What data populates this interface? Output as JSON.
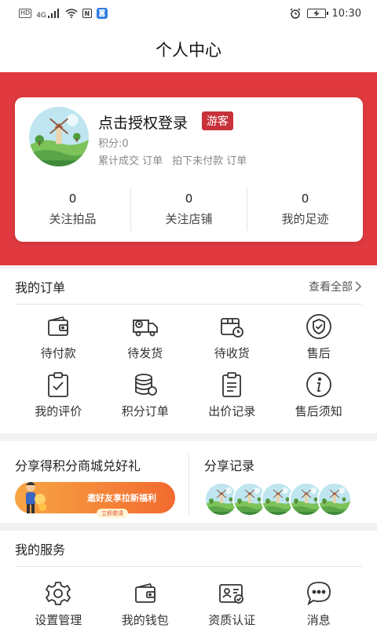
{
  "status_bar": {
    "hd": "HD",
    "network": "4G",
    "nfc": "N",
    "time": "10:30"
  },
  "header": {
    "title": "个人中心"
  },
  "profile": {
    "login_text": "点击授权登录",
    "badge": "游客",
    "points": "积分:0",
    "completed_orders": "累计成交 订单",
    "unpaid_orders": "拍下未付款 订单",
    "stats": [
      {
        "value": "0",
        "label": "关注拍品"
      },
      {
        "value": "0",
        "label": "关注店铺"
      },
      {
        "value": "0",
        "label": "我的足迹"
      }
    ]
  },
  "orders": {
    "title": "我的订单",
    "view_all": "查看全部",
    "items": [
      {
        "label": "待付款",
        "icon": "wallet-icon"
      },
      {
        "label": "待发货",
        "icon": "delivery-truck-icon"
      },
      {
        "label": "待收货",
        "icon": "package-clock-icon"
      },
      {
        "label": "售后",
        "icon": "shield-check-icon"
      },
      {
        "label": "我的评价",
        "icon": "clipboard-check-icon"
      },
      {
        "label": "积分订单",
        "icon": "coins-stack-icon"
      },
      {
        "label": "出价记录",
        "icon": "clipboard-list-icon"
      },
      {
        "label": "售后须知",
        "icon": "info-icon"
      }
    ]
  },
  "share": {
    "left_title": "分享得积分商城兑好礼",
    "banner_text": "邀好友享拉新福利",
    "banner_sub": "立即邀请",
    "right_title": "分享记录"
  },
  "services": {
    "title": "我的服务",
    "items": [
      {
        "label": "设置管理",
        "icon": "gear-icon"
      },
      {
        "label": "我的钱包",
        "icon": "wallet-icon"
      },
      {
        "label": "资质认证",
        "icon": "id-card-icon"
      },
      {
        "label": "消息",
        "icon": "chat-bubble-icon"
      }
    ]
  },
  "colors": {
    "brand_red": "#e03a40",
    "badge_red": "#c8323a",
    "banner_orange": "#f26a2f"
  }
}
